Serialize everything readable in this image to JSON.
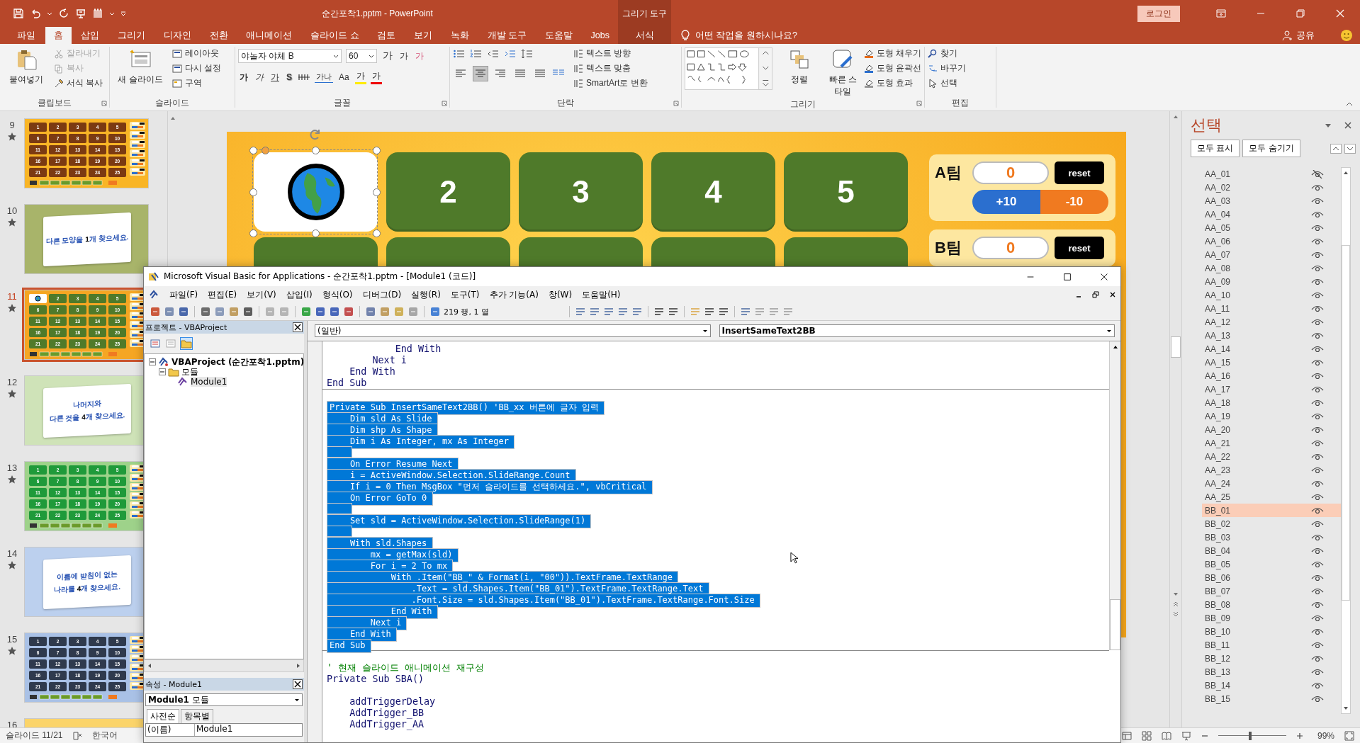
{
  "app": {
    "title": "순간포착1.pptm  -  PowerPoint",
    "context_header": "그리기 도구",
    "login": "로그인"
  },
  "tabs": [
    {
      "label": "파일",
      "selected": false,
      "kind": "standard"
    },
    {
      "label": "홈",
      "selected": true,
      "kind": "standard"
    },
    {
      "label": "삽입",
      "selected": false,
      "kind": "standard"
    },
    {
      "label": "그리기",
      "selected": false,
      "kind": "standard"
    },
    {
      "label": "디자인",
      "selected": false,
      "kind": "standard"
    },
    {
      "label": "전환",
      "selected": false,
      "kind": "standard"
    },
    {
      "label": "애니메이션",
      "selected": false,
      "kind": "standard"
    },
    {
      "label": "슬라이드 쇼",
      "selected": false,
      "kind": "standard"
    },
    {
      "label": "검토",
      "selected": false,
      "kind": "standard"
    },
    {
      "label": "보기",
      "selected": false,
      "kind": "standard"
    },
    {
      "label": "녹화",
      "selected": false,
      "kind": "standard"
    },
    {
      "label": "개발 도구",
      "selected": false,
      "kind": "standard"
    },
    {
      "label": "도움말",
      "selected": false,
      "kind": "standard"
    },
    {
      "label": "Jobs",
      "selected": false,
      "kind": "standard"
    },
    {
      "label": "서식",
      "selected": false,
      "kind": "contextual"
    }
  ],
  "tell_me": "어떤 작업을 원하시나요?",
  "share": "공유",
  "ribbon": {
    "clipboard": {
      "label": "클립보드",
      "paste": "붙여넣기",
      "commands": [
        {
          "label": "잘라내기",
          "disabled": true
        },
        {
          "label": "복사",
          "disabled": true
        },
        {
          "label": "서식 복사",
          "disabled": false
        }
      ]
    },
    "slides": {
      "label": "슬라이드",
      "new_slide": "새 슬라이드",
      "commands": [
        "레이아웃",
        "다시 설정",
        "구역"
      ]
    },
    "font": {
      "label": "글꼴",
      "face": "야놀자 야체 B",
      "size": "60",
      "grow": "가",
      "shrink": "가",
      "clear": "가",
      "format_buttons": [
        {
          "kind": "bold",
          "label": "가"
        },
        {
          "kind": "italic",
          "label": "가"
        },
        {
          "kind": "underline",
          "label": "가"
        },
        {
          "kind": "shadow",
          "label": "S"
        },
        {
          "kind": "strike"
        },
        {
          "kind": "spacing",
          "label": "가나"
        },
        {
          "kind": "case",
          "label": "Aa"
        },
        {
          "kind": "highlight",
          "label": "가"
        },
        {
          "kind": "color",
          "label": "가"
        }
      ]
    },
    "paragraph": {
      "label": "단락",
      "alignment": [
        {
          "selected": false
        },
        {
          "selected": true
        },
        {
          "selected": false
        },
        {
          "selected": false
        },
        {
          "selected": false
        }
      ],
      "commands": [
        "텍스트 방향",
        "텍스트 맞춤",
        "SmartArt로 변환"
      ]
    },
    "drawing": {
      "label": "그리기",
      "arrange": "정렬",
      "quick_styles": "빠른 스타일",
      "commands": [
        "도형 채우기",
        "도형 윤곽선",
        "도형 효과"
      ]
    },
    "editing": {
      "label": "편집",
      "commands": [
        "찾기",
        "바꾸기",
        "선택"
      ]
    }
  },
  "thumbnails": [
    {
      "number": "9",
      "selected": false,
      "animated": true,
      "kind": "grid",
      "color": "#f9b526",
      "picture_tile": false,
      "tile_group": {
        "color": "#7b3a12",
        "labels": [
          "1",
          "2",
          "3",
          "4",
          "5",
          "6",
          "7",
          "8",
          "9",
          "10",
          "11",
          "12",
          "13",
          "14",
          "15",
          "16",
          "17",
          "18",
          "19",
          "20",
          "21",
          "22",
          "23",
          "24",
          "25"
        ]
      }
    },
    {
      "number": "10",
      "selected": false,
      "animated": true,
      "kind": "text",
      "color": "#a8b46a",
      "lines": [
        "다른 모양을 **1**개 찾으세요."
      ]
    },
    {
      "number": "11",
      "selected": true,
      "animated": true,
      "kind": "grid",
      "color": "#f5a623",
      "picture_tile": true,
      "tile_group": {
        "color": "#4f7a2a",
        "labels": [
          "2",
          "3",
          "4",
          "5",
          "6",
          "7",
          "8",
          "9",
          "10",
          "11",
          "12",
          "13",
          "14",
          "15",
          "16",
          "17",
          "18",
          "19",
          "20",
          "21",
          "22",
          "23",
          "24",
          "25"
        ]
      }
    },
    {
      "number": "12",
      "selected": false,
      "animated": true,
      "kind": "text",
      "color": "#cfe3b8",
      "lines": [
        "나머지와",
        "다른 것을 **4**개 찾으세요."
      ]
    },
    {
      "number": "13",
      "selected": false,
      "animated": true,
      "kind": "grid",
      "color": "#9ed28a",
      "picture_tile": false,
      "tile_group": {
        "color": "#1f9a3a",
        "labels": [
          "1",
          "2",
          "3",
          "4",
          "5",
          "6",
          "7",
          "8",
          "9",
          "10",
          "11",
          "12",
          "13",
          "14",
          "15",
          "16",
          "17",
          "18",
          "19",
          "20",
          "21",
          "22",
          "23",
          "24",
          "25"
        ]
      }
    },
    {
      "number": "14",
      "selected": false,
      "animated": true,
      "kind": "text",
      "color": "#bcd0ee",
      "lines": [
        "이름에 받침이 없는",
        "나라를 **4**개 찾으세요."
      ]
    },
    {
      "number": "15",
      "selected": false,
      "animated": true,
      "kind": "grid",
      "color": "#a9c1e6",
      "picture_tile": false,
      "tile_group": {
        "color": "#2f3a4d",
        "labels": [
          "1",
          "2",
          "3",
          "4",
          "5",
          "6",
          "7",
          "8",
          "9",
          "10",
          "11",
          "12",
          "13",
          "14",
          "15",
          "16",
          "17",
          "18",
          "19",
          "20",
          "21",
          "22",
          "23",
          "24",
          "25"
        ]
      }
    },
    {
      "number": "16",
      "selected": false,
      "kind": "cut",
      "color": "#fbd46a"
    }
  ],
  "slide": {
    "tiles": [
      {
        "kind": "picture",
        "selected": true
      },
      {
        "kind": "number",
        "label": "2",
        "selected": false
      },
      {
        "kind": "number",
        "label": "3",
        "selected": false
      },
      {
        "kind": "number",
        "label": "4",
        "selected": false
      },
      {
        "kind": "number",
        "label": "5",
        "selected": false
      }
    ],
    "teams": [
      {
        "name": "A팀",
        "score": "0",
        "reset": "reset",
        "plus": "+10",
        "minus": "-10"
      },
      {
        "name": "B팀",
        "score": "0",
        "reset": "reset"
      }
    ]
  },
  "selection_pane": {
    "title": "선택",
    "show_all": "모두 표시",
    "hide_all": "모두 숨기기",
    "items": [
      {
        "name": "AA_01",
        "visible": false,
        "selected": false
      },
      {
        "name": "AA_02",
        "visible": true,
        "selected": false
      },
      {
        "name": "AA_03",
        "visible": true,
        "selected": false
      },
      {
        "name": "AA_04",
        "visible": true,
        "selected": false
      },
      {
        "name": "AA_05",
        "visible": true,
        "selected": false
      },
      {
        "name": "AA_06",
        "visible": true,
        "selected": false
      },
      {
        "name": "AA_07",
        "visible": true,
        "selected": false
      },
      {
        "name": "AA_08",
        "visible": true,
        "selected": false
      },
      {
        "name": "AA_09",
        "visible": true,
        "selected": false
      },
      {
        "name": "AA_10",
        "visible": true,
        "selected": false
      },
      {
        "name": "AA_11",
        "visible": true,
        "selected": false
      },
      {
        "name": "AA_12",
        "visible": true,
        "selected": false
      },
      {
        "name": "AA_13",
        "visible": true,
        "selected": false
      },
      {
        "name": "AA_14",
        "visible": true,
        "selected": false
      },
      {
        "name": "AA_15",
        "visible": true,
        "selected": false
      },
      {
        "name": "AA_16",
        "visible": true,
        "selected": false
      },
      {
        "name": "AA_17",
        "visible": true,
        "selected": false
      },
      {
        "name": "AA_18",
        "visible": true,
        "selected": false
      },
      {
        "name": "AA_19",
        "visible": true,
        "selected": false
      },
      {
        "name": "AA_20",
        "visible": true,
        "selected": false
      },
      {
        "name": "AA_21",
        "visible": true,
        "selected": false
      },
      {
        "name": "AA_22",
        "visible": true,
        "selected": false
      },
      {
        "name": "AA_23",
        "visible": true,
        "selected": false
      },
      {
        "name": "AA_24",
        "visible": true,
        "selected": false
      },
      {
        "name": "AA_25",
        "visible": true,
        "selected": false
      },
      {
        "name": "BB_01",
        "visible": true,
        "selected": true
      },
      {
        "name": "BB_02",
        "visible": true,
        "selected": false
      },
      {
        "name": "BB_03",
        "visible": true,
        "selected": false
      },
      {
        "name": "BB_04",
        "visible": true,
        "selected": false
      },
      {
        "name": "BB_05",
        "visible": true,
        "selected": false
      },
      {
        "name": "BB_06",
        "visible": true,
        "selected": false
      },
      {
        "name": "BB_07",
        "visible": true,
        "selected": false
      },
      {
        "name": "BB_08",
        "visible": true,
        "selected": false
      },
      {
        "name": "BB_09",
        "visible": true,
        "selected": false
      },
      {
        "name": "BB_10",
        "visible": true,
        "selected": false
      },
      {
        "name": "BB_11",
        "visible": true,
        "selected": false
      },
      {
        "name": "BB_12",
        "visible": true,
        "selected": false
      },
      {
        "name": "BB_13",
        "visible": true,
        "selected": false
      },
      {
        "name": "BB_14",
        "visible": true,
        "selected": false
      },
      {
        "name": "BB_15",
        "visible": true,
        "selected": false
      }
    ]
  },
  "status_bar": {
    "slide": "슬라이드 11/21",
    "language": "한국어",
    "zoom": "99%",
    "zoom_level": {
      "level": 0.45
    }
  },
  "vba": {
    "title": "Microsoft Visual Basic for Applications - 순간포착1.pptm - [Module1 (코드)]",
    "menu": [
      "파일(F)",
      "편집(E)",
      "보기(V)",
      "삽입(I)",
      "형식(O)",
      "디버그(D)",
      "실행(R)",
      "도구(T)",
      "추가 기능(A)",
      "창(W)",
      "도움말(H)"
    ],
    "position": "219 행, 1 열",
    "project": {
      "title": "프로젝트 - VBAProject",
      "tree": [
        {
          "label": "VBAProject (순간포착1.pptm)",
          "expanded": true,
          "selected": false,
          "children": [
            {
              "label": "모듈",
              "expanded": true,
              "selected": false,
              "children": [
                {
                  "label": "Module1",
                  "selected": true
                }
              ]
            }
          ]
        }
      ]
    },
    "properties": {
      "title": "속성 - Module1",
      "object": "Module1",
      "object_type": "모듈",
      "tabs": [
        {
          "label": "사전순",
          "selected": true
        },
        {
          "label": "항목별",
          "selected": false
        }
      ],
      "rows": [
        {
          "name": "(이름)",
          "value": "Module1"
        }
      ]
    },
    "code": {
      "object": "(일반)",
      "procedure": "InsertSameText2BB",
      "blocks": [
        {
          "lines": [
            {
              "kind": "code",
              "text": "            End With",
              "selected": false
            },
            {
              "kind": "code",
              "text": "        Next i",
              "selected": false
            },
            {
              "kind": "code",
              "text": "    End With",
              "selected": false
            },
            {
              "kind": "code",
              "text": "End Sub",
              "selected": false
            }
          ]
        },
        {
          "lines": [
            {
              "kind": "blank",
              "selected": false
            },
            {
              "kind": "code",
              "text": "Private Sub InsertSameText2BB() 'BB_xx 버튼에 글자 입력",
              "selected": true
            },
            {
              "kind": "code",
              "text": "    Dim sld As Slide",
              "selected": true
            },
            {
              "kind": "code",
              "text": "    Dim shp As Shape",
              "selected": true
            },
            {
              "kind": "code",
              "text": "    Dim i As Integer, mx As Integer",
              "selected": true
            },
            {
              "kind": "blank",
              "selected": true
            },
            {
              "kind": "code",
              "text": "    On Error Resume Next",
              "selected": true
            },
            {
              "kind": "code",
              "text": "    i = ActiveWindow.Selection.SlideRange.Count",
              "selected": true
            },
            {
              "kind": "code",
              "text": "    If i = 0 Then MsgBox \"먼저 슬라이드를 선택하세요.\", vbCritical",
              "selected": true
            },
            {
              "kind": "code",
              "text": "    On Error GoTo 0",
              "selected": true
            },
            {
              "kind": "blank",
              "selected": true
            },
            {
              "kind": "code",
              "text": "    Set sld = ActiveWindow.Selection.SlideRange(1)",
              "selected": true
            },
            {
              "kind": "blank",
              "selected": true
            },
            {
              "kind": "code",
              "text": "    With sld.Shapes",
              "selected": true
            },
            {
              "kind": "code",
              "text": "        mx = getMax(sld)",
              "selected": true
            },
            {
              "kind": "code",
              "text": "        For i = 2 To mx",
              "selected": true
            },
            {
              "kind": "code",
              "text": "            With .Item(\"BB_\" & Format(i, \"00\")).TextFrame.TextRange",
              "selected": true
            },
            {
              "kind": "code",
              "text": "                .Text = sld.Shapes.Item(\"BB_01\").TextFrame.TextRange.Text",
              "selected": true
            },
            {
              "kind": "code",
              "text": "                .Font.Size = sld.Shapes.Item(\"BB_01\").TextFrame.TextRange.Font.Size",
              "selected": true
            },
            {
              "kind": "code",
              "text": "            End With",
              "selected": true
            },
            {
              "kind": "code",
              "text": "        Next i",
              "selected": true
            },
            {
              "kind": "code",
              "text": "    End With",
              "selected": true
            },
            {
              "kind": "code",
              "text": "End Sub",
              "selected": true
            }
          ]
        },
        {
          "lines": [
            {
              "kind": "blank",
              "selected": false
            },
            {
              "kind": "comment",
              "text": "' 현재 슬라이드 애니메이션 재구성",
              "selected": false
            },
            {
              "kind": "code",
              "text": "Private Sub SBA()",
              "selected": false
            },
            {
              "kind": "blank",
              "selected": false
            },
            {
              "kind": "code",
              "text": "    addTriggerDelay",
              "selected": false
            },
            {
              "kind": "code",
              "text": "    AddTrigger_BB",
              "selected": false
            },
            {
              "kind": "code",
              "text": "    AddTrigger_AA",
              "selected": false
            }
          ]
        }
      ]
    }
  }
}
